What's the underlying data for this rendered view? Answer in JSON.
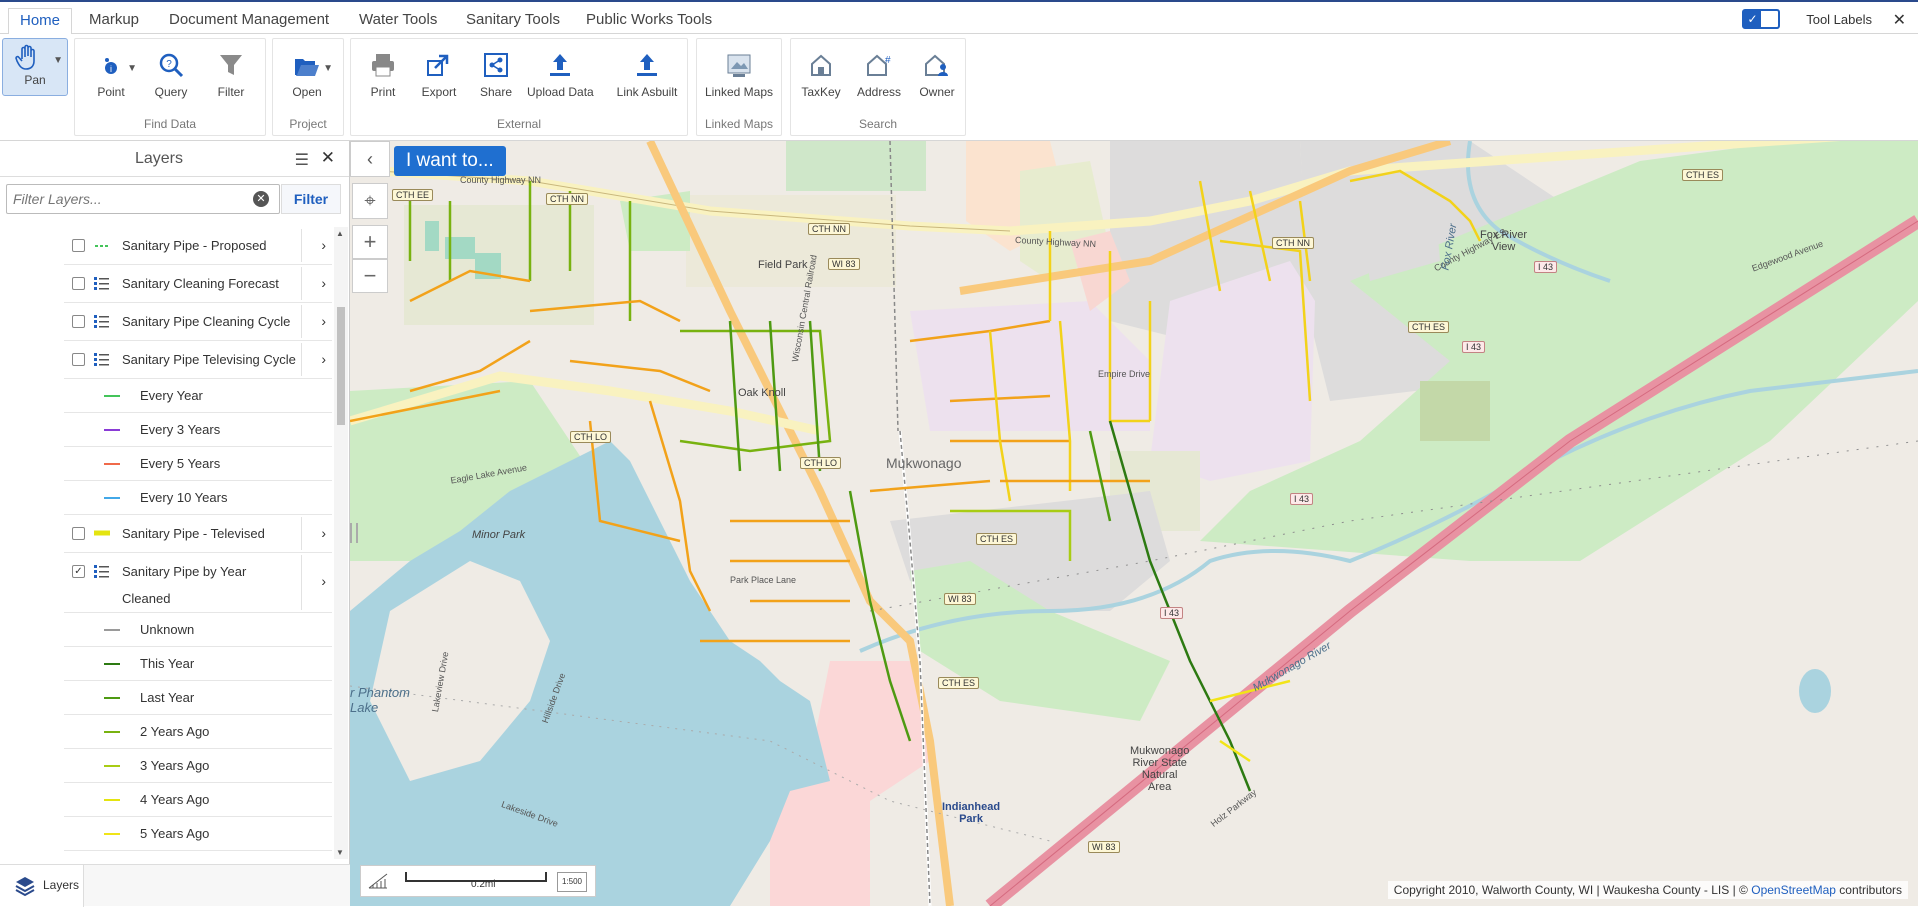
{
  "tabs": [
    "Home",
    "Markup",
    "Document Management",
    "Water Tools",
    "Sanitary Tools",
    "Public Works Tools"
  ],
  "tool_labels": "Tool Labels",
  "ribbon": {
    "pan": "Pan",
    "point": "Point",
    "query": "Query",
    "filter": "Filter",
    "find_data": "Find Data",
    "open": "Open",
    "project": "Project",
    "print": "Print",
    "export": "Export",
    "share": "Share",
    "upload_data": "Upload Data",
    "link_asbuilt": "Link Asbuilt",
    "external": "External",
    "linked_maps": "Linked Maps",
    "linked_maps_group": "Linked Maps",
    "taxkey": "TaxKey",
    "address": "Address",
    "owner": "Owner",
    "search": "Search"
  },
  "layers": {
    "title": "Layers",
    "filter_placeholder": "Filter Layers...",
    "filter_button": "Filter",
    "footer_label": "Layers",
    "items": [
      {
        "name": "Sanitary Pipe - Proposed",
        "checked": false
      },
      {
        "name": "Sanitary Cleaning Forecast",
        "checked": false
      },
      {
        "name": "Sanitary Pipe Cleaning Cycle",
        "checked": false
      },
      {
        "name": "Sanitary Pipe Televising Cycle",
        "checked": false
      },
      {
        "name": "Sanitary Pipe - Televised",
        "checked": false
      },
      {
        "name": "Sanitary Pipe by Year Cleaned",
        "checked": true
      }
    ],
    "televising_legend": [
      {
        "label": "Every Year",
        "color": "#44c45a"
      },
      {
        "label": "Every 3 Years",
        "color": "#8a3bd6"
      },
      {
        "label": "Every 5 Years",
        "color": "#f06a4a"
      },
      {
        "label": "Every 10 Years",
        "color": "#42a8e8"
      }
    ],
    "year_legend": [
      {
        "label": "Unknown",
        "color": "#9a9a9a"
      },
      {
        "label": "This Year",
        "color": "#2d7a12"
      },
      {
        "label": "Last Year",
        "color": "#4e9a12"
      },
      {
        "label": "2 Years Ago",
        "color": "#78b210"
      },
      {
        "label": "3 Years Ago",
        "color": "#a8cc14"
      },
      {
        "label": "4 Years Ago",
        "color": "#e4e410"
      },
      {
        "label": "5 Years Ago",
        "color": "#f0e418"
      }
    ]
  },
  "map": {
    "iwant": "I want to...",
    "scale_text": "0.2mi",
    "scale_unit": "1:500",
    "copyright_prefix": "Copyright 2010, Walworth County, WI | Waukesha County - LIS | ©",
    "copyright_link": "OpenStreetMap",
    "copyright_suffix": "contributors",
    "labels": {
      "county_hwy_nn_w": "County Highway NN",
      "cth_nn_1": "CTH NN",
      "cth_nn_2": "CTH NN",
      "county_hwy_nn_e": "County Highway NN",
      "cth_nn_3": "CTH NN",
      "cth_ee": "CTH EE",
      "cth_es_ne": "CTH ES",
      "county_hwy_es": "County Highway ES",
      "cth_es_mid": "CTH ES",
      "wi83_top": "WI 83",
      "field_park": "Field Park",
      "oak_knoll": "Oak Knoll",
      "cth_lo_w": "CTH LO",
      "cth_lo_e": "CTH LO",
      "mukwonago": "Mukwonago",
      "eagle_lake_avenue": "Eagle Lake Avenue",
      "minor_park": "Minor Park",
      "phantom_lake": "r Phantom\nLake",
      "cth_es_center": "CTH ES",
      "wi83_mid": "WI 83",
      "cth_es_south": "CTH ES",
      "indianhead_park": "Indianhead\nPark",
      "wi83_bottom": "WI 83",
      "mukwonago_river_sna": "Mukwonago\nRiver State\nNatural\nArea",
      "mukwonago_river": "Mukwonago River",
      "fox_river_view": "Fox River\nView",
      "fox_river": "Fox River",
      "i43_1": "I 43",
      "i43_2": "I 43",
      "i43_3": "I 43",
      "i43_4": "I 43",
      "empire_drive": "Empire Drive",
      "holz_parkway": "Holz Parkway",
      "wisconsin_central_railroad": "Wisconsin Central Railroad",
      "lakeview_drive": "Lakeview Drive",
      "lakeside_drive": "Lakeside Drive",
      "hillside_drive": "Hillside Drive",
      "park_place_lane": "Park Place Lane",
      "edgewood_avenue": "Edgewood Avenue"
    }
  },
  "colors": {
    "accent": "#1f5fbf",
    "water": "#aad3df",
    "park": "#c8facc",
    "interstate": "#e892a2",
    "primary_road": "#f9f2c0"
  },
  "icons": {
    "pan": "hand-icon",
    "point": "point-info-icon",
    "query": "query-icon",
    "filter": "funnel-icon",
    "open": "folder-icon",
    "print": "printer-icon",
    "export": "export-icon",
    "share": "share-icon",
    "upload": "upload-icon",
    "link_asbuilt": "upload-icon",
    "linked_maps": "linked-maps-icon",
    "taxkey": "taxkey-icon",
    "address": "address-icon",
    "owner": "owner-icon"
  }
}
